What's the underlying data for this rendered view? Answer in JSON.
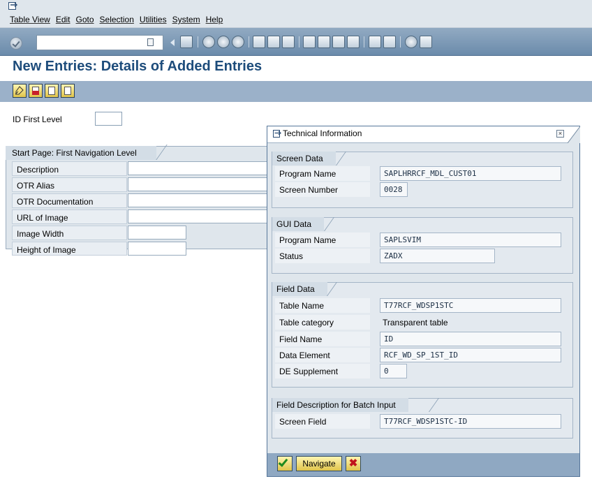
{
  "menu": [
    "Table View",
    "Edit",
    "Goto",
    "Selection",
    "Utilities",
    "System",
    "Help"
  ],
  "page_title": "New Entries: Details of Added Entries",
  "id_first_level": {
    "label": "ID First Level",
    "value": ""
  },
  "group": {
    "title": "Start Page: First Navigation Level",
    "rows": [
      {
        "label": "Description",
        "value": ""
      },
      {
        "label": "OTR Alias",
        "value": ""
      },
      {
        "label": "OTR Documentation",
        "value": ""
      },
      {
        "label": "URL of Image",
        "value": ""
      },
      {
        "label": "Image Width",
        "value": ""
      },
      {
        "label": "Height of Image",
        "value": ""
      }
    ]
  },
  "dialog": {
    "title": "Technical Information",
    "screen_data": {
      "title": "Screen Data",
      "program_name_label": "Program Name",
      "program_name_value": "SAPLHRRCF_MDL_CUST01",
      "screen_number_label": "Screen Number",
      "screen_number_value": "0028"
    },
    "gui_data": {
      "title": "GUI Data",
      "program_name_label": "Program Name",
      "program_name_value": "SAPLSVIM",
      "status_label": "Status",
      "status_value": "ZADX"
    },
    "field_data": {
      "title": "Field Data",
      "table_name_label": "Table Name",
      "table_name_value": "T77RCF_WDSP1STC",
      "table_category_label": "Table category",
      "table_category_value": "Transparent table",
      "field_name_label": "Field Name",
      "field_name_value": "ID",
      "data_element_label": "Data Element",
      "data_element_value": "RCF_WD_SP_1ST_ID",
      "de_supplement_label": "DE Supplement",
      "de_supplement_value": "0"
    },
    "batch_input": {
      "title": "Field Description for Batch Input",
      "screen_field_label": "Screen Field",
      "screen_field_value": "T77RCF_WDSP1STC-ID"
    },
    "buttons": {
      "navigate": "Navigate"
    }
  },
  "colors": {
    "title_blue": "#1d4c7b",
    "toolbar_blue": "#7a97b5",
    "panel_gray": "#dfe6ec",
    "button_yellow": "#f2d96a",
    "cancel_red": "#c0141c",
    "ok_green": "#1f8a1f"
  }
}
